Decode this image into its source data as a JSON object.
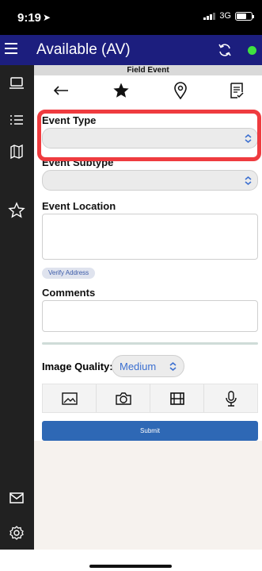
{
  "status_bar": {
    "time": "9:19",
    "network": "3G"
  },
  "header": {
    "title": "Available (AV)",
    "status_color": "#3fe13f"
  },
  "panel": {
    "title": "Field Event",
    "toolbar": [
      "back-arrow-icon",
      "star-icon",
      "location-pin-icon",
      "notes-icon"
    ]
  },
  "form": {
    "event_type": {
      "label": "Event Type",
      "value": ""
    },
    "event_subtype": {
      "label": "Event Subtype",
      "value": ""
    },
    "event_location": {
      "label": "Event Location",
      "value": ""
    },
    "verify_address_label": "Verify Address",
    "comments": {
      "label": "Comments",
      "value": ""
    },
    "image_quality": {
      "label": "Image Quality:",
      "value": "Medium"
    },
    "media_buttons": [
      "image-icon",
      "camera-icon",
      "film-icon",
      "microphone-icon"
    ],
    "submit_label": "Submit"
  },
  "sidebar": [
    "laptop-icon",
    "list-icon",
    "map-icon",
    "star-outline-icon",
    "mail-icon",
    "settings-icon"
  ],
  "colors": {
    "header": "#1c1e7e",
    "accent": "#2e68b5",
    "highlight": "#ef3b3f"
  }
}
